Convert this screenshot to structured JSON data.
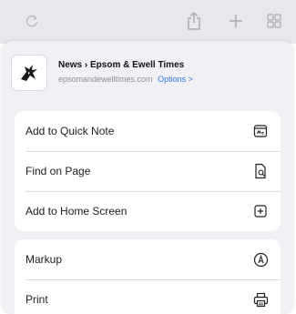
{
  "toolbar": {
    "reload_icon": "reload-icon",
    "share_icon": "share-icon",
    "new_tab_icon": "plus-icon",
    "tabs_icon": "grid-icon"
  },
  "site": {
    "title": "News › Epsom & Ewell Times",
    "domain": "epsomandewelltimes.com",
    "options_label": "Options >",
    "logo_icon": "site-logo-icon"
  },
  "actions_group1": [
    {
      "label": "Add to Quick Note",
      "icon": "quick-note-icon"
    },
    {
      "label": "Find on Page",
      "icon": "find-on-page-icon"
    },
    {
      "label": "Add to Home Screen",
      "icon": "add-home-screen-icon"
    }
  ],
  "actions_group2": [
    {
      "label": "Markup",
      "icon": "markup-icon"
    },
    {
      "label": "Print",
      "icon": "print-icon"
    }
  ],
  "colors": {
    "accent": "#2d7be5",
    "sheet_bg": "#f1f1f5",
    "toolbar_bg": "#e8e8ec",
    "icon_gray": "#b0b0b6"
  }
}
